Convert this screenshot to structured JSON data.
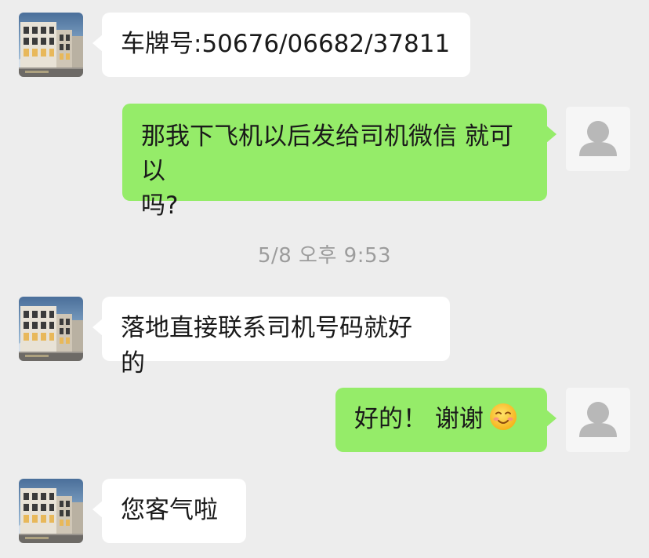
{
  "chat": {
    "messages": [
      {
        "sender": "other",
        "text": "车牌号:50676/06682/37811"
      },
      {
        "sender": "me",
        "text": "那我下飞机以后发给司机微信 就可以\n吗?"
      },
      {
        "sender": "other",
        "text": "落地直接联系司机号码就好的"
      },
      {
        "sender": "me",
        "text": "好的！ 谢谢",
        "emoji": "smiling-face-emoji"
      },
      {
        "sender": "other",
        "text": "您客气啦"
      }
    ],
    "timestamp": "5/8 오후 9:53"
  },
  "colors": {
    "background": "#ededed",
    "incoming_bubble": "#ffffff",
    "outgoing_bubble": "#95ec69",
    "timestamp_text": "#9c9c9c"
  },
  "icons": {
    "other_avatar": "building-photo-avatar",
    "my_avatar": "default-person-avatar-icon"
  }
}
